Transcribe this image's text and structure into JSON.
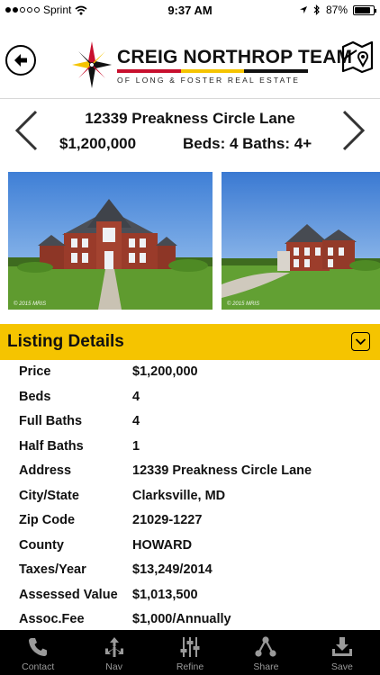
{
  "status_bar": {
    "carrier": "Sprint",
    "time": "9:37 AM",
    "battery": "87%",
    "battery_level": 0.87
  },
  "header": {
    "logo_title": "CREIG NORTHROP TEAM",
    "logo_subtitle": "OF LONG & FOSTER REAL ESTATE",
    "back_icon": "back-arrow-icon",
    "map_icon": "map-pin-icon"
  },
  "summary": {
    "address": "12339 Preakness Circle Lane",
    "price": "$1,200,000",
    "beds_baths": "Beds: 4  Baths: 4+"
  },
  "photos": {
    "watermark_1": "© 2015 MRIS",
    "watermark_2": "© 2015 MRIS"
  },
  "details": {
    "title": "Listing Details",
    "rows": [
      {
        "label": "Price",
        "value": "$1,200,000"
      },
      {
        "label": "Beds",
        "value": "4"
      },
      {
        "label": "Full Baths",
        "value": "4"
      },
      {
        "label": "Half Baths",
        "value": "1"
      },
      {
        "label": "Address",
        "value": "12339 Preakness Circle Lane"
      },
      {
        "label": "City/State",
        "value": "Clarksville, MD"
      },
      {
        "label": "Zip Code",
        "value": "21029-1227"
      },
      {
        "label": "County",
        "value": "HOWARD"
      },
      {
        "label": "Taxes/Year",
        "value": "$13,249/2014"
      },
      {
        "label": "Assessed Value",
        "value": "$1,013,500"
      },
      {
        "label": "Assoc.Fee",
        "value": "$1,000/Annually"
      }
    ]
  },
  "tabbar": {
    "tabs": [
      {
        "label": "Contact",
        "icon": "phone-icon"
      },
      {
        "label": "Nav",
        "icon": "arrows-icon"
      },
      {
        "label": "Refine",
        "icon": "sliders-icon"
      },
      {
        "label": "Share",
        "icon": "share-icon"
      },
      {
        "label": "Save",
        "icon": "download-icon"
      }
    ]
  },
  "colors": {
    "accent_yellow": "#f5c400",
    "logo_red": "#c8102e",
    "tab_bar": "#000000",
    "tab_label": "#9a9a9a"
  }
}
